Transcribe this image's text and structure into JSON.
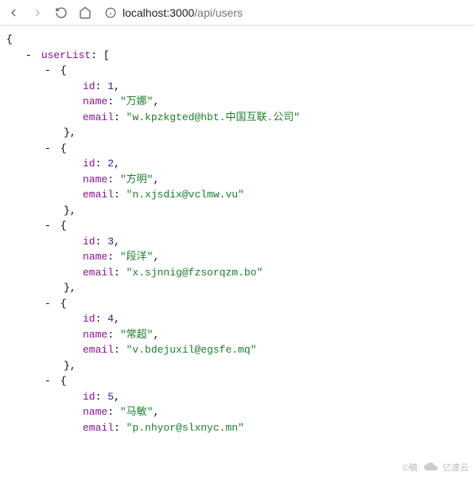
{
  "toolbar": {
    "url_host": "localhost:3000",
    "url_path": "/api/users"
  },
  "json": {
    "rootKey": "userList",
    "items": [
      {
        "id": 1,
        "name": "万娜",
        "email": "w.kpzkgted@hbt.中国互联.公司"
      },
      {
        "id": 2,
        "name": "方明",
        "email": "n.xjsdix@vclmw.vu"
      },
      {
        "id": 3,
        "name": "段洋",
        "email": "x.sjnnig@fzsorqzm.bo"
      },
      {
        "id": 4,
        "name": "常超",
        "email": "v.bdejuxil@egsfe.mq"
      },
      {
        "id": 5,
        "name": "马敏",
        "email": "p.nhyor@slxnyc.mn"
      }
    ],
    "keys": {
      "id": "id",
      "name": "name",
      "email": "email"
    }
  },
  "watermark": {
    "prefix": "©稿:",
    "brand": "亿速云"
  }
}
